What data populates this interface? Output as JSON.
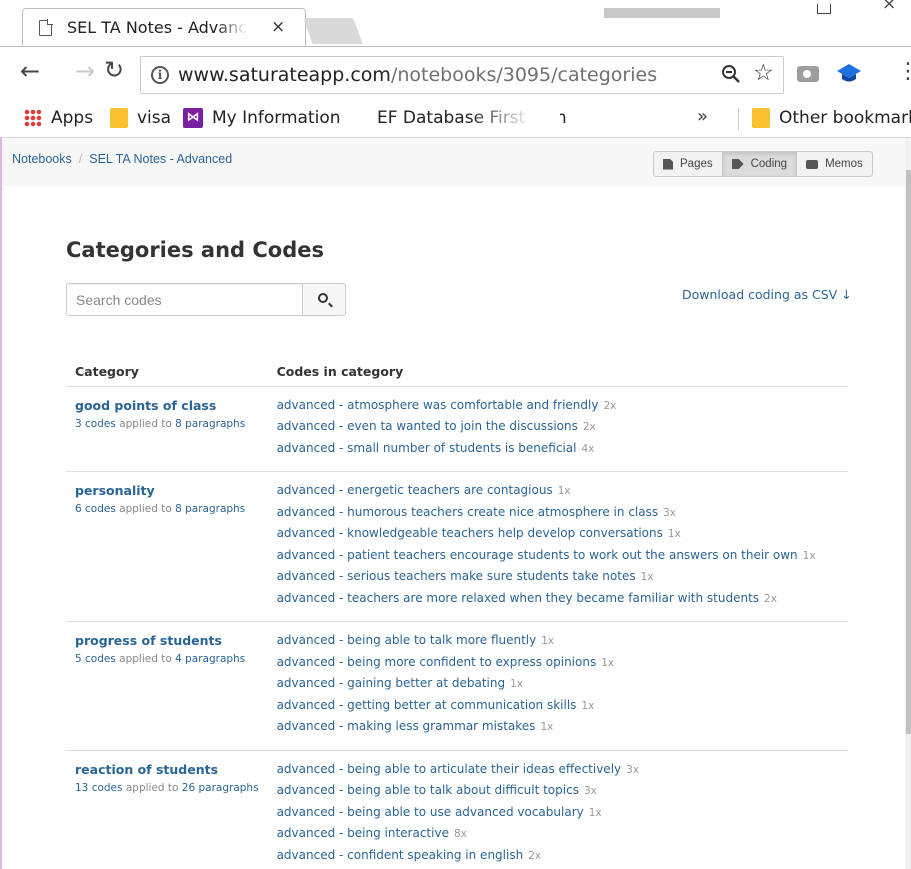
{
  "browser": {
    "tab_title": "SEL TA Notes - Advanced",
    "tab_close": "×",
    "url_host": "www.saturateapp.com",
    "url_path": "/notebooks/3095/categories",
    "bookmarks": [
      {
        "label": "Apps",
        "icon": "apps-grid-icon"
      },
      {
        "label": "visa",
        "icon": "folder-icon"
      },
      {
        "label": "My Information",
        "icon": "visual-studio-icon"
      },
      {
        "label": "EF Database First with",
        "icon": "microsoft-icon"
      }
    ],
    "overflow": "»",
    "other_bookmarks": "Other bookmarks"
  },
  "breadcrumb": {
    "root": "Notebooks",
    "separator": "/",
    "current": "SEL TA Notes - Advanced"
  },
  "view_buttons": {
    "pages": "Pages",
    "coding": "Coding",
    "memos": "Memos",
    "active": "Coding"
  },
  "page": {
    "title": "Categories and Codes",
    "search_placeholder": "Search codes",
    "download_link": "Download coding as CSV ↓"
  },
  "table": {
    "col_category": "Category",
    "col_codes": "Codes in category",
    "applied_to": "applied to",
    "rows": [
      {
        "name": "good points of class",
        "codes_count": "3 codes",
        "paragraphs": "8 paragraphs",
        "codes": [
          {
            "text": "advanced - atmosphere was comfortable and friendly",
            "count": "2x"
          },
          {
            "text": "advanced - even ta wanted to join the discussions",
            "count": "2x"
          },
          {
            "text": "advanced - small number of students is beneficial",
            "count": "4x"
          }
        ]
      },
      {
        "name": "personality",
        "codes_count": "6 codes",
        "paragraphs": "8 paragraphs",
        "codes": [
          {
            "text": "advanced - energetic teachers are contagious",
            "count": "1x"
          },
          {
            "text": "advanced - humorous teachers create nice atmosphere in class",
            "count": "3x"
          },
          {
            "text": "advanced - knowledgeable teachers help develop conversations",
            "count": "1x"
          },
          {
            "text": "advanced - patient teachers encourage students to work out the answers on their own",
            "count": "1x"
          },
          {
            "text": "advanced - serious teachers make sure students take notes",
            "count": "1x"
          },
          {
            "text": "advanced - teachers are more relaxed when they became familiar with students",
            "count": "2x"
          }
        ]
      },
      {
        "name": "progress of students",
        "codes_count": "5 codes",
        "paragraphs": "4 paragraphs",
        "codes": [
          {
            "text": "advanced - being able to talk more fluently",
            "count": "1x"
          },
          {
            "text": "advanced - being more confident to express opinions",
            "count": "1x"
          },
          {
            "text": "advanced - gaining better at debating",
            "count": "1x"
          },
          {
            "text": "advanced - getting better at communication skills",
            "count": "1x"
          },
          {
            "text": "advanced - making less grammar mistakes",
            "count": "1x"
          }
        ]
      },
      {
        "name": "reaction of students",
        "codes_count": "13 codes",
        "paragraphs": "26 paragraphs",
        "codes": [
          {
            "text": "advanced - being able to articulate their ideas effectively",
            "count": "3x"
          },
          {
            "text": "advanced - being able to talk about difficult topics",
            "count": "3x"
          },
          {
            "text": "advanced - being able to use advanced vocabulary",
            "count": "1x"
          },
          {
            "text": "advanced - being interactive",
            "count": "8x"
          },
          {
            "text": "advanced - confident speaking in english",
            "count": "2x"
          }
        ]
      }
    ]
  },
  "colors": {
    "link": "#2a6496",
    "muted": "#888888",
    "divider": "#dddddd"
  }
}
